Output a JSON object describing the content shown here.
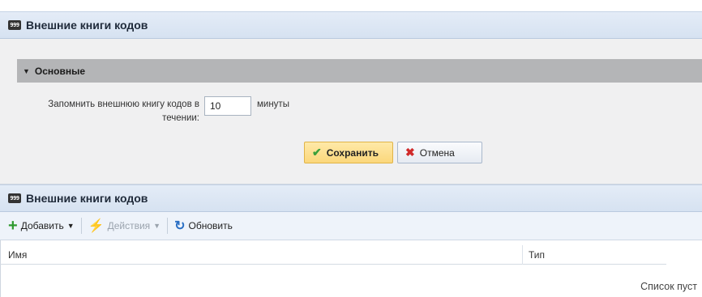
{
  "panel1": {
    "icon": "999",
    "title": "Внешние книги кодов"
  },
  "fieldset": {
    "title": "Основные"
  },
  "form": {
    "label": "Запомнить внешнюю книгу кодов в течении:",
    "value": "10",
    "unit": "минуты"
  },
  "buttons": {
    "save": "Сохранить",
    "cancel": "Отмена"
  },
  "panel2": {
    "icon": "999",
    "title": "Внешние книги кодов"
  },
  "toolbar": {
    "add": "Добавить",
    "actions": "Действия",
    "refresh": "Обновить"
  },
  "grid": {
    "columns": [
      "Имя",
      "Тип"
    ],
    "empty_text": "Список пуст"
  }
}
